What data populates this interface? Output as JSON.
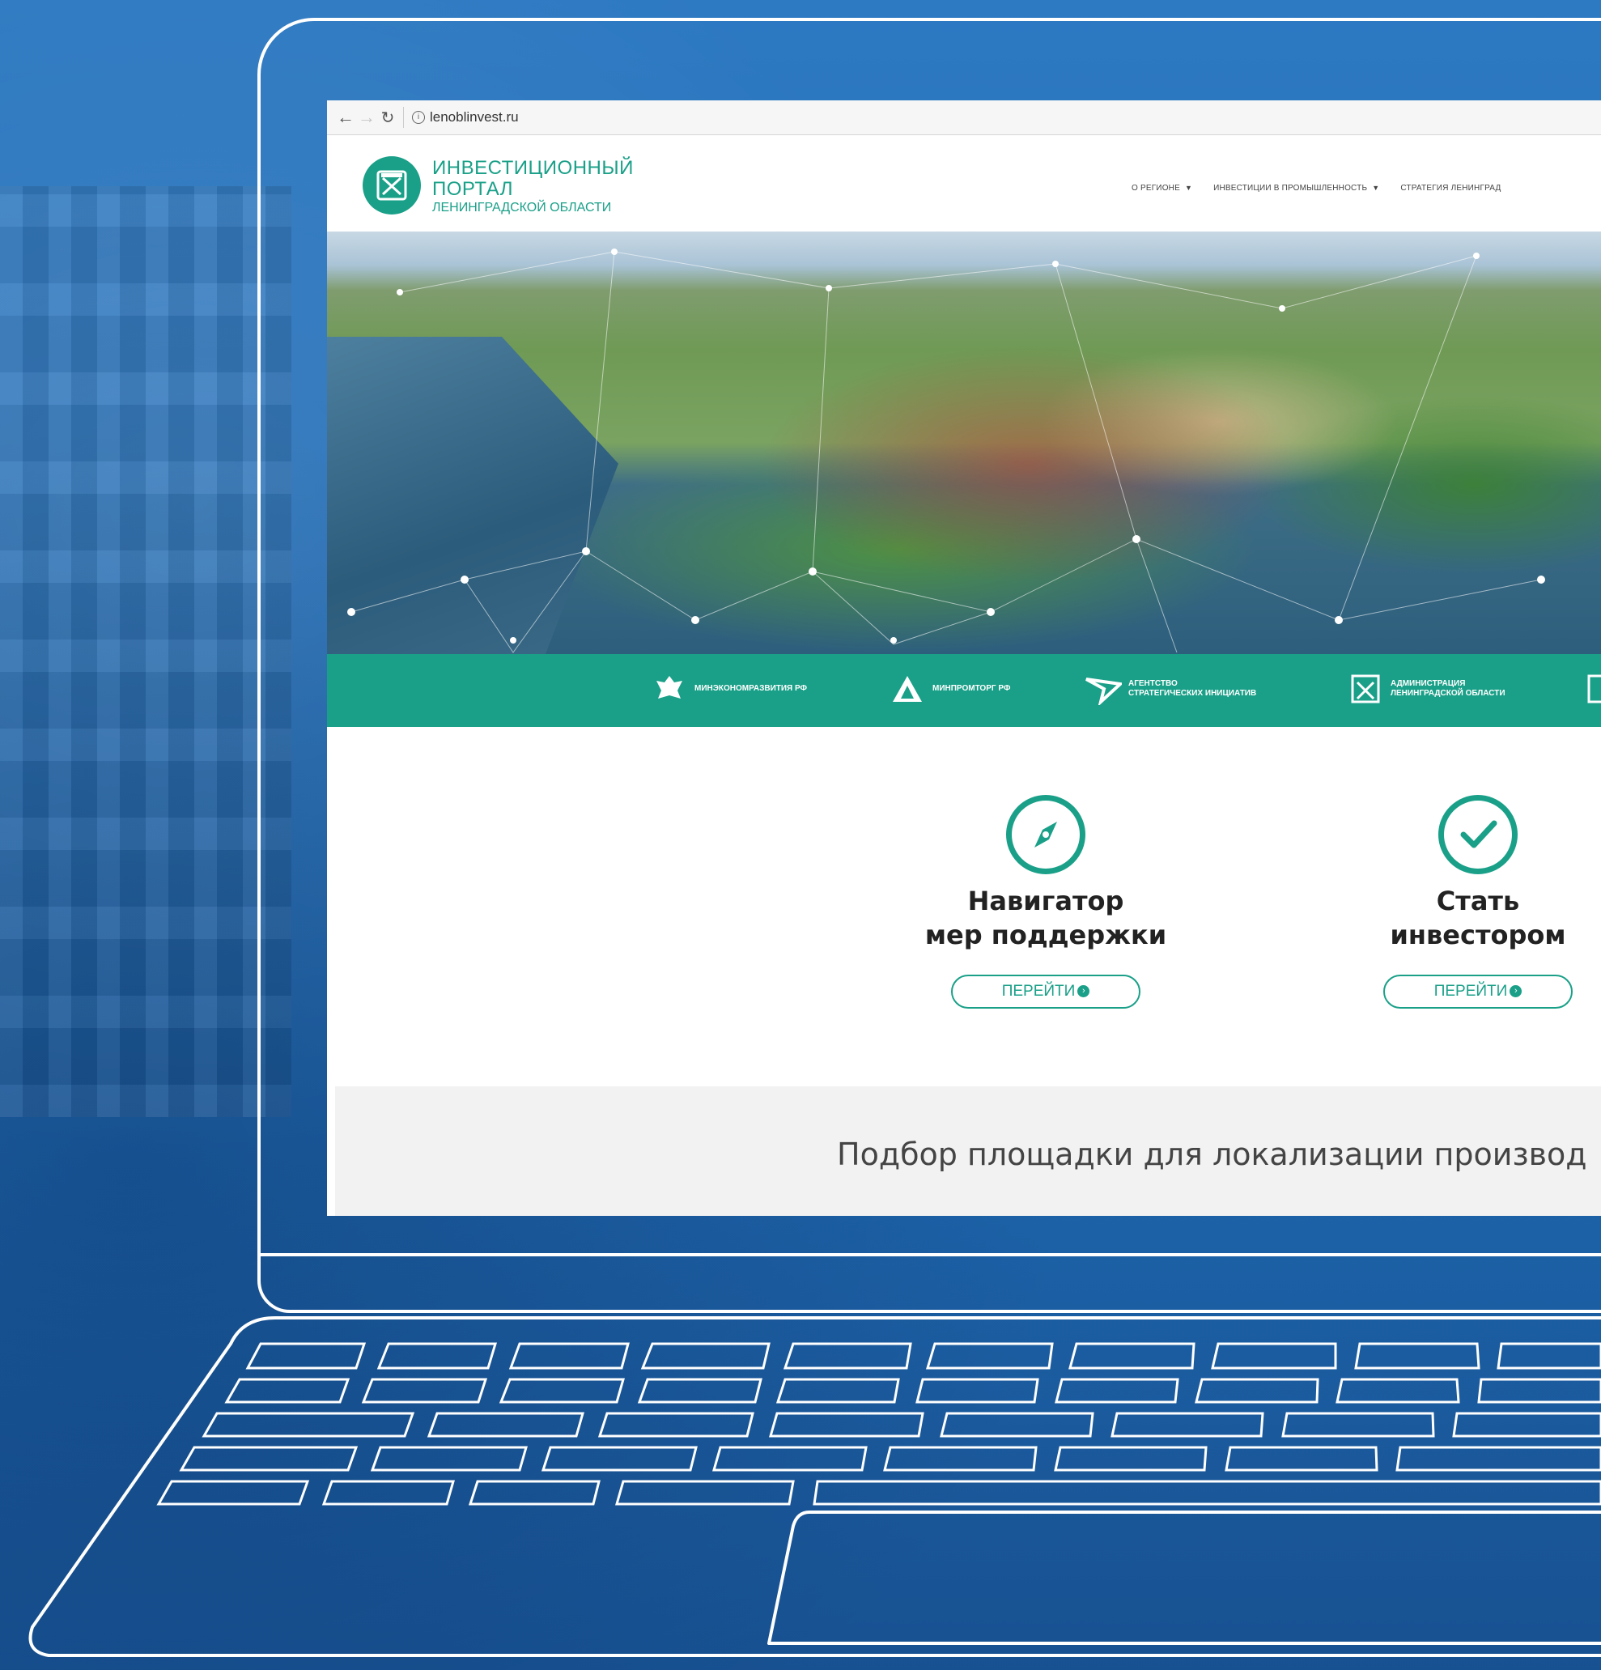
{
  "browser": {
    "back_icon": "arrow-left-icon",
    "forward_icon": "arrow-right-icon",
    "reload_icon": "reload-icon",
    "url": "lenoblinvest.ru"
  },
  "site": {
    "logo_line1": "ИНВЕСТИЦИОННЫЙ",
    "logo_line2": "ПОРТАЛ",
    "logo_line3": "ЛЕНИНГРАДСКОЙ ОБЛАСТИ",
    "accent_color": "#1aa088",
    "menu": [
      {
        "label": "О РЕГИОНЕ"
      },
      {
        "label": "ИНВЕСТИЦИИ В ПРОМЫШЛЕННОСТЬ"
      },
      {
        "label": "СТРАТЕГИЯ ЛЕНИНГРАД"
      }
    ]
  },
  "partners": [
    {
      "label": "МИНЭКОНОМРАЗВИТИЯ РФ",
      "icon": "eagle-emblem-icon"
    },
    {
      "label": "МИНПРОМТОРГ РФ",
      "icon": "triangle-logo-icon"
    },
    {
      "label_line1": "АГЕНТСТВО",
      "label_line2": "СТРАТЕГИЧЕСКИХ ИНИЦИАТИВ",
      "icon": "asi-logo-icon"
    },
    {
      "label_line1": "АДМИНИСТРАЦИЯ",
      "label_line2": "ЛЕНИНГРАДСКОЙ ОБЛАСТИ",
      "icon": "coat-of-arms-icon"
    }
  ],
  "cards": [
    {
      "title_line1": "Навигатор",
      "title_line2": "мер поддержки",
      "button": "ПЕРЕЙТИ",
      "icon": "compass-icon"
    },
    {
      "title_line1": "Стать",
      "title_line2": "инвестором",
      "button": "ПЕРЕЙТИ",
      "icon": "checkmark-circle-icon"
    }
  ],
  "select_section": {
    "text": "Подбор площадки для локализации производ"
  }
}
